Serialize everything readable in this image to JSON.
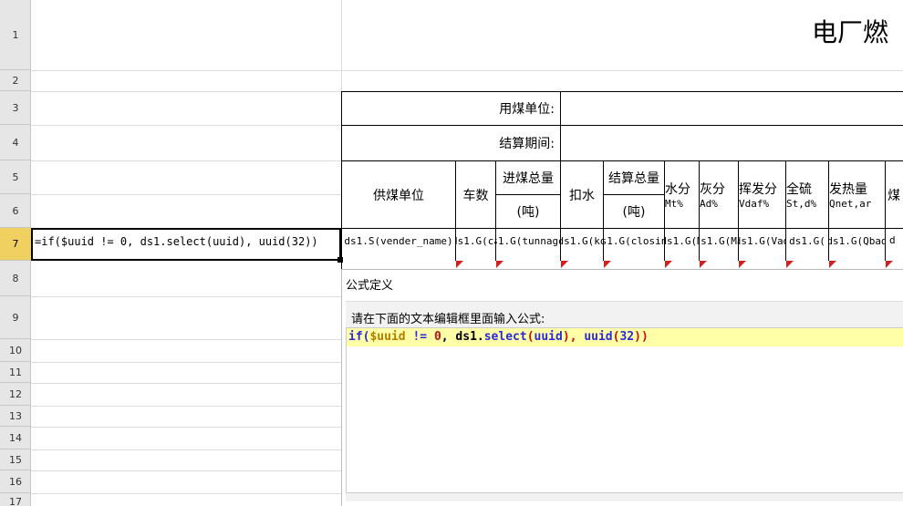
{
  "rows": [
    "1",
    "2",
    "3",
    "4",
    "5",
    "6",
    "7",
    "8",
    "9",
    "10",
    "11",
    "12",
    "13",
    "14",
    "15",
    "16",
    "17"
  ],
  "title": "电厂燃",
  "table": {
    "coal_user_label": "用煤单位:",
    "period_label": "结算期间:",
    "headers": {
      "supplier": "供煤单位",
      "cars": "车数",
      "incoming_total": "进煤总量",
      "incoming_unit": "(吨)",
      "deduct_water": "扣水",
      "settle_total": "结算总量",
      "settle_unit": "(吨)",
      "moisture": "水分",
      "moisture_sub": "Mt%",
      "ash": "灰分",
      "ash_sub": "Ad%",
      "volatile": "挥发分",
      "volatile_sub": "Vdaf%",
      "sulfur": "全硫",
      "sulfur_sub": "St,d%",
      "heat": "发热量",
      "heat_sub": "Qnet,ar",
      "coal_cut": "煤"
    },
    "row7": {
      "supplier": "ds1.S(vender_name)",
      "cars": "ds1.G(ca",
      "incoming": "ds1.G(tunnage)",
      "deduct": "ds1.G(ko",
      "settle": "ds1.G(closing",
      "moisture": "ds1.G(M",
      "ash": "ds1.G(Ma",
      "volatile": "ds1.G(Vad",
      "sulfur": "ds1.G(",
      "heat": "ds1.G(Qbad",
      "last": "d"
    }
  },
  "formula_cell": "=if($uuid != 0, ds1.select(uuid), uuid(32))",
  "dialog": {
    "title": "公式定义",
    "prompt": "请在下面的文本编辑框里面输入公式:",
    "tokens": {
      "t1": "if",
      "t2": "(",
      "t3": "$uuid",
      "t4": " != ",
      "t5": "0",
      "t6": ", ds1.",
      "t7": "select",
      "t8": "(",
      "t9": "uuid",
      "t10": "), ",
      "t11": "uuid",
      "t12": "(",
      "t13": "32",
      "t14": "))"
    }
  },
  "colors": {
    "selected_row": "#f0d060",
    "editor_highlight": "#ffffa8",
    "keyword": "#2a2ad8",
    "variable": "#b08000",
    "number": "#c01010"
  }
}
